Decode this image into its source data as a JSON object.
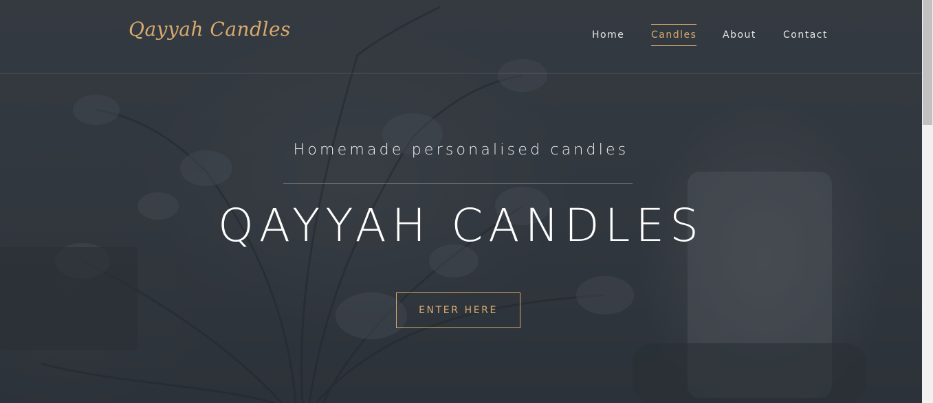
{
  "header": {
    "logo": "Qayyah Candles",
    "nav": [
      {
        "label": "Home",
        "active": false
      },
      {
        "label": "Candles",
        "active": true
      },
      {
        "label": "About",
        "active": false
      },
      {
        "label": "Contact",
        "active": false
      }
    ]
  },
  "hero": {
    "tagline": "Homemade personalised candles",
    "title": "QAYYAH CANDLES",
    "cta_label": "ENTER HERE"
  },
  "colors": {
    "accent": "#d8aa6e",
    "background": "#3a4047",
    "text": "#ffffff"
  }
}
